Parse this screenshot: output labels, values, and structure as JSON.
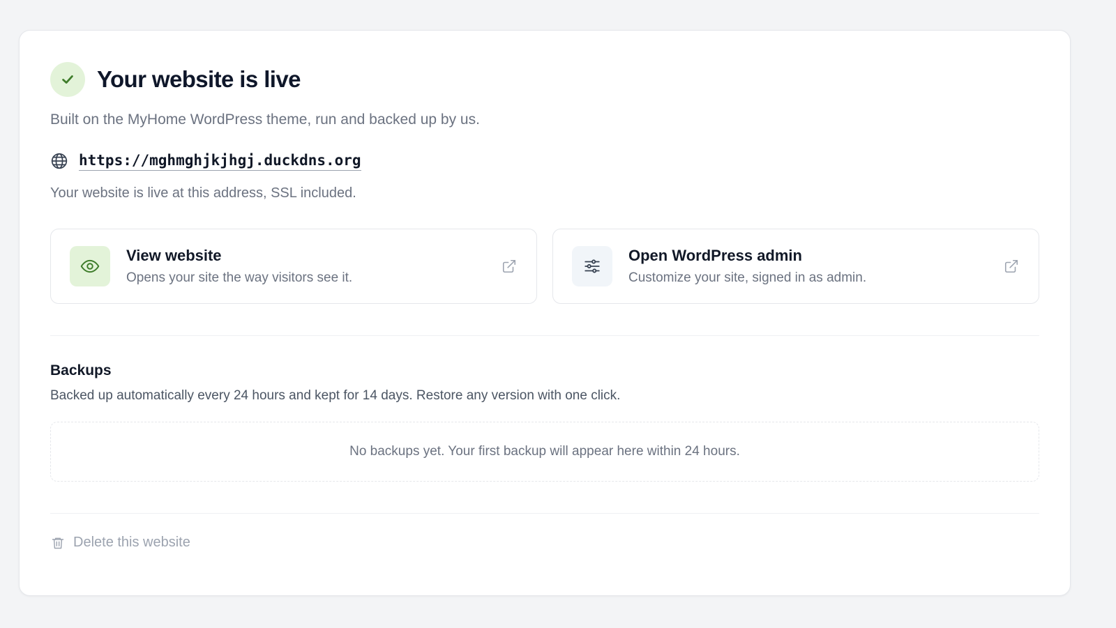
{
  "header": {
    "title": "Your website is live",
    "subtitle": "Built on the MyHome WordPress theme, run and backed up by us."
  },
  "site": {
    "url": "https://mghmghjkjhgj.duckdns.org",
    "note": "Your website is live at this address, SSL included."
  },
  "actions": [
    {
      "title": "View website",
      "description": "Opens your site the way visitors see it.",
      "icon": "eye-icon"
    },
    {
      "title": "Open WordPress admin",
      "description": "Customize your site, signed in as admin.",
      "icon": "sliders-icon"
    }
  ],
  "backups": {
    "title": "Backups",
    "description": "Backed up automatically every 24 hours and kept for 14 days. Restore any version with one click.",
    "empty_message": "No backups yet. Your first backup will appear here within 24 hours."
  },
  "danger": {
    "delete_label": "Delete this website"
  },
  "colors": {
    "accent_green": "#3f7d2b",
    "accent_green_bg": "#e3f3d9",
    "text_muted": "#6b7280"
  }
}
